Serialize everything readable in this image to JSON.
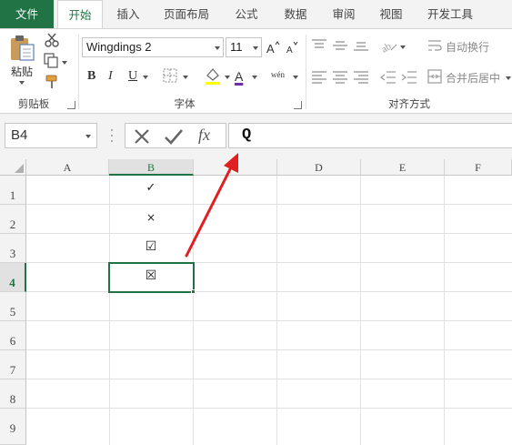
{
  "tabs": [
    {
      "label": "文件"
    },
    {
      "label": "开始"
    },
    {
      "label": "插入"
    },
    {
      "label": "页面布局"
    },
    {
      "label": "公式"
    },
    {
      "label": "数据"
    },
    {
      "label": "审阅"
    },
    {
      "label": "视图"
    },
    {
      "label": "开发工具"
    }
  ],
  "ribbon": {
    "clipboard": {
      "paste_label": "粘贴",
      "group_label": "剪贴板"
    },
    "font": {
      "font_name": "Wingdings 2",
      "font_size": "11",
      "bold": "B",
      "italic": "I",
      "underline": "U",
      "font_color_letter": "A",
      "phonetic_letter": "wén",
      "group_label": "字体"
    },
    "alignment": {
      "wrap_text": "自动换行",
      "merge_center": "合并后居中",
      "group_label": "对齐方式"
    }
  },
  "formula_bar": {
    "cell_ref": "B4",
    "formula": "Q",
    "cancel_icon": "✕",
    "enter_icon": "✔",
    "fx_label": "fx"
  },
  "columns": [
    "A",
    "B",
    "C",
    "D",
    "E",
    "F"
  ],
  "rows": [
    "1",
    "2",
    "3",
    "4",
    "5",
    "6",
    "7",
    "8",
    "9"
  ],
  "cells": {
    "B1": "✓",
    "B2": "×",
    "B3": "☑",
    "B4": "☒"
  },
  "selected_cell": "B4",
  "colors": {
    "accent": "#217346",
    "arrow": "#e02020",
    "font_color_bar": "#7030a0"
  }
}
